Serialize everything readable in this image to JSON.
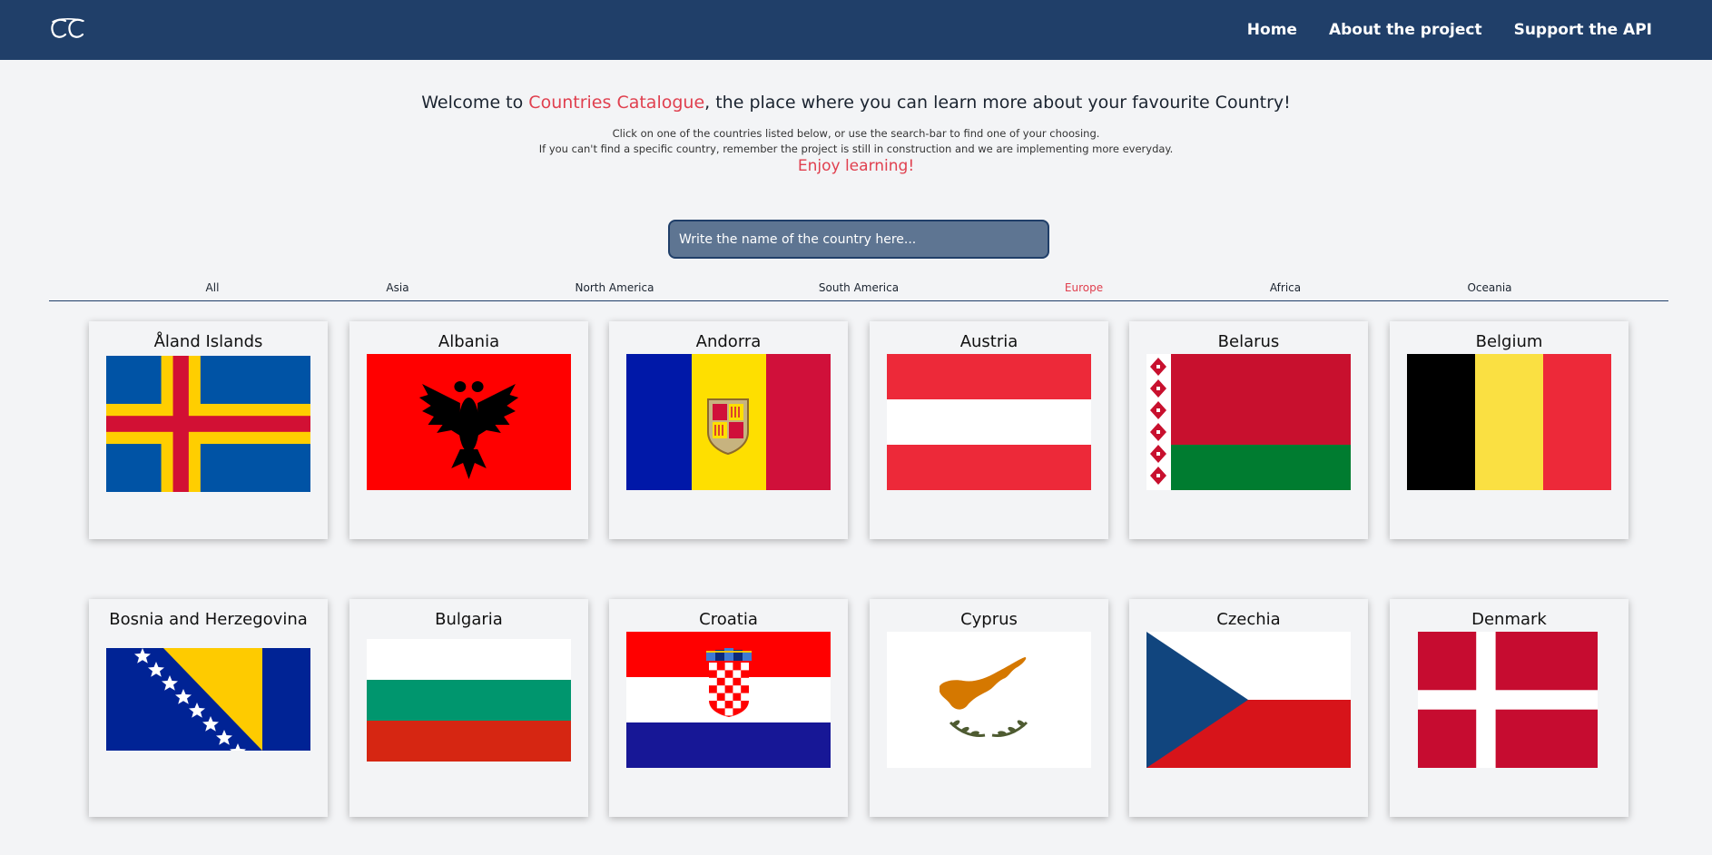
{
  "nav": {
    "logo_text": "CC",
    "links": [
      "Home",
      "About the project",
      "Support the API"
    ]
  },
  "hero": {
    "welcome_before": "Welcome to ",
    "brand": "Countries Catalogue",
    "welcome_after": ", the place where you can learn more about your favourite Country!",
    "line1": "Click on one of the countries listed below, or use the search-bar to find one of your choosing.",
    "line2": "If you can't find a specific country, remember the project is still in construction and we are implementing more everyday.",
    "enjoy": "Enjoy learning!"
  },
  "search": {
    "placeholder": "Write the name of the country here...",
    "value": ""
  },
  "filters": {
    "items": [
      "All",
      "Asia",
      "North America",
      "South America",
      "Europe",
      "Africa",
      "Oceania"
    ],
    "active": "Europe"
  },
  "colors": {
    "navbar": "#203f69",
    "accent": "#e0404f",
    "search_bg": "#5e7592",
    "page_bg": "#f3f4f6"
  },
  "countries": [
    {
      "name": "Åland Islands",
      "flag_icon": "aland-flag-icon"
    },
    {
      "name": "Albania",
      "flag_icon": "albania-flag-icon"
    },
    {
      "name": "Andorra",
      "flag_icon": "andorra-flag-icon"
    },
    {
      "name": "Austria",
      "flag_icon": "austria-flag-icon"
    },
    {
      "name": "Belarus",
      "flag_icon": "belarus-flag-icon"
    },
    {
      "name": "Belgium",
      "flag_icon": "belgium-flag-icon"
    },
    {
      "name": "Bosnia and Herzegovina",
      "flag_icon": "bosnia-flag-icon"
    },
    {
      "name": "Bulgaria",
      "flag_icon": "bulgaria-flag-icon"
    },
    {
      "name": "Croatia",
      "flag_icon": "croatia-flag-icon"
    },
    {
      "name": "Cyprus",
      "flag_icon": "cyprus-flag-icon"
    },
    {
      "name": "Czechia",
      "flag_icon": "czechia-flag-icon"
    },
    {
      "name": "Denmark",
      "flag_icon": "denmark-flag-icon"
    }
  ]
}
